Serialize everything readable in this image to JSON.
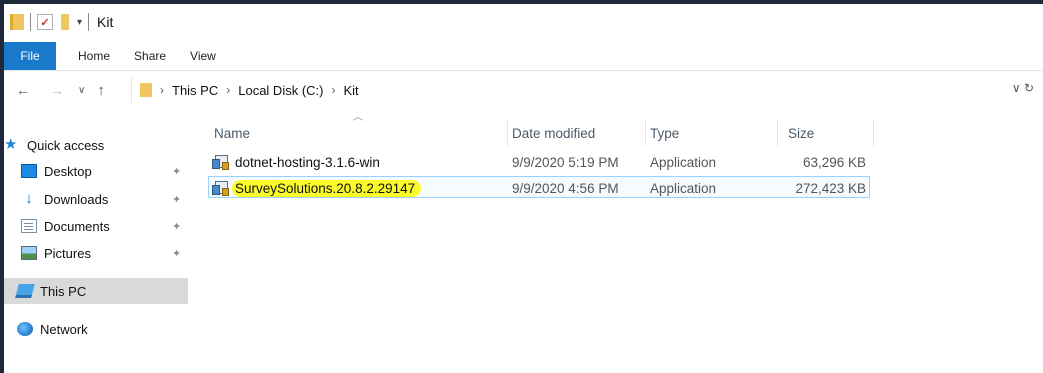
{
  "window": {
    "title": "Kit"
  },
  "ribbon": {
    "tabs": [
      "File",
      "Home",
      "Share",
      "View"
    ]
  },
  "address": {
    "crumbs": [
      "This PC",
      "Local Disk (C:)",
      "Kit"
    ]
  },
  "nav_pane": {
    "quick_access": "Quick access",
    "items": [
      {
        "label": "Desktop",
        "icon": "desktop-icon",
        "pinned": true
      },
      {
        "label": "Downloads",
        "icon": "download-icon",
        "pinned": true
      },
      {
        "label": "Documents",
        "icon": "documents-icon",
        "pinned": true
      },
      {
        "label": "Pictures",
        "icon": "pictures-icon",
        "pinned": true
      }
    ],
    "this_pc": "This PC",
    "network": "Network"
  },
  "columns": {
    "name": "Name",
    "date": "Date modified",
    "type": "Type",
    "size": "Size"
  },
  "files": [
    {
      "name": "dotnet-hosting-3.1.6-win",
      "date": "9/9/2020 5:19 PM",
      "type": "Application",
      "size": "63,296 KB"
    },
    {
      "name": "SurveySolutions.20.8.2.29147",
      "date": "9/9/2020 4:56 PM",
      "type": "Application",
      "size": "272,423 KB",
      "highlighted": true
    }
  ],
  "colors": {
    "accent": "#1979ca",
    "highlight": "#fbfb2a",
    "selection_border": "#99d1ff"
  }
}
